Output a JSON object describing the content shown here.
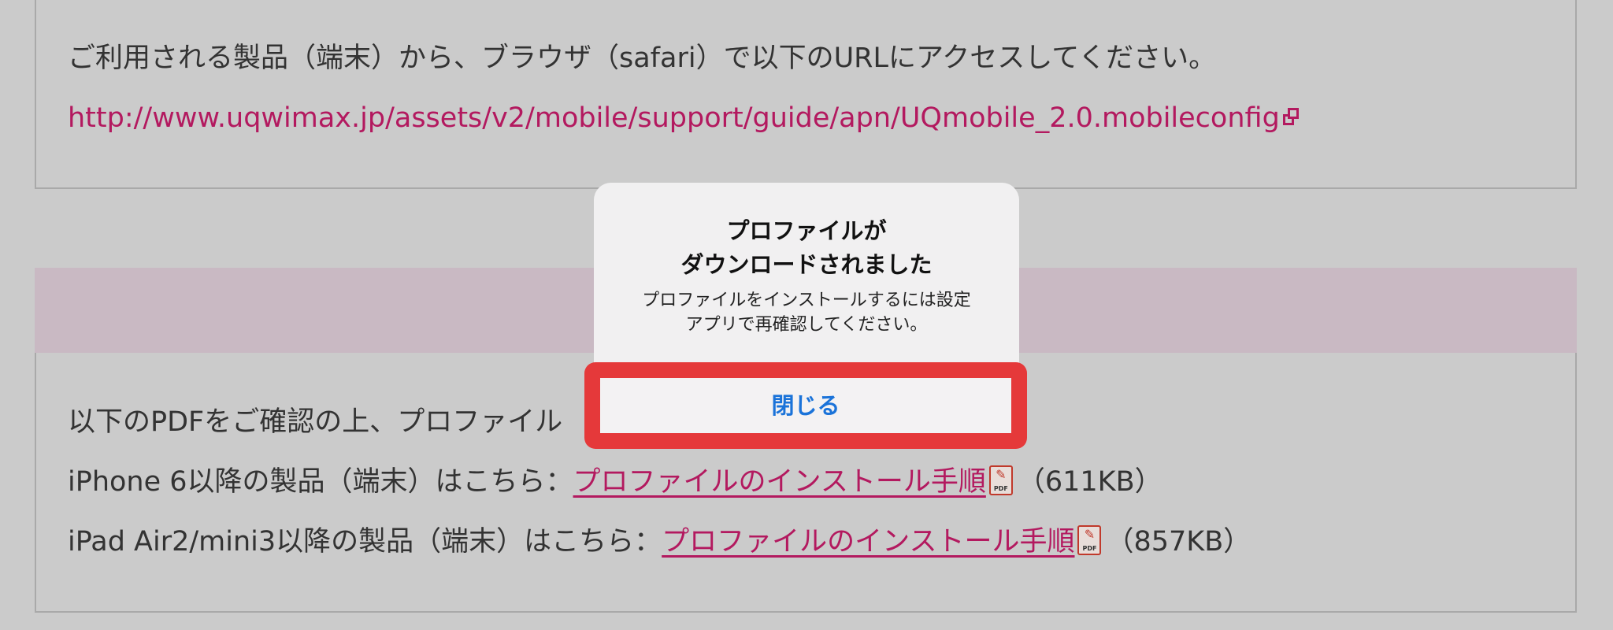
{
  "top_section": {
    "instruction": "ご利用される製品（端末）から、ブラウザ（safari）で以下のURLにアクセスしてください。",
    "config_url": "http://www.uqwimax.jp/assets/v2/mobile/support/guide/apn/UQmobile_2.0.mobileconfig",
    "external_icon": "external-link-icon"
  },
  "bottom_section": {
    "intro": "以下のPDFをご確認の上、プロファイル",
    "rows": [
      {
        "prefix": "iPhone 6以降の製品（端末）はこちら：",
        "link": "プロファイルのインストール手順",
        "size": "（611KB）"
      },
      {
        "prefix": "iPad Air2/mini3以降の製品（端末）はこちら：",
        "link": "プロファイルのインストール手順",
        "size": "（857KB）"
      }
    ],
    "pdf_icon_label": "PDF"
  },
  "dialog": {
    "title": "プロファイルが\nダウンロードされました",
    "message": "プロファイルをインストールするには設定\nアプリで再確認してください。",
    "close_label": "閉じる"
  },
  "colors": {
    "link": "#b3195f",
    "highlight": "#e5393a",
    "button_text": "#1a73d9",
    "overlay_bg": "#cbcbcb"
  }
}
